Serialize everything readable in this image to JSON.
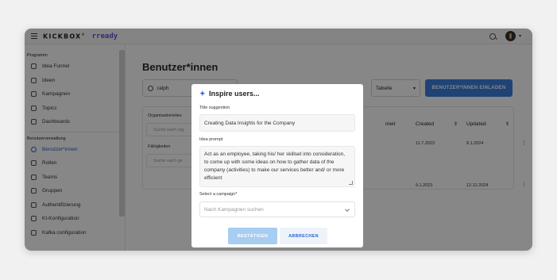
{
  "topbar": {
    "brand": "KICKBOX",
    "brand_mark": "®",
    "product": "rready"
  },
  "sidebar": {
    "section_program": "Programm",
    "program_items": [
      {
        "label": "Idea Funnel",
        "icon": "funnel-icon"
      },
      {
        "label": "Ideen",
        "icon": "lightbulb-icon"
      },
      {
        "label": "Kampagnen",
        "icon": "megaphone-icon"
      },
      {
        "label": "Topics",
        "icon": "tag-icon"
      },
      {
        "label": "Dashboards",
        "icon": "chart-icon"
      }
    ],
    "section_user_admin": "Benutzerverwaltung",
    "admin_items": [
      {
        "label": "Benutzer*innen",
        "icon": "user-icon",
        "active": true
      },
      {
        "label": "Rollen",
        "icon": "roles-icon"
      },
      {
        "label": "Teams",
        "icon": "team-icon"
      },
      {
        "label": "Gruppen",
        "icon": "groups-icon"
      },
      {
        "label": "Authentifizierung",
        "icon": "key-icon"
      },
      {
        "label": "KI-Konfiguration",
        "icon": "ai-icon"
      },
      {
        "label": "Kafka configuration",
        "icon": "kafka-icon"
      }
    ]
  },
  "main": {
    "title": "Benutzer*innen",
    "search_value": "ralph",
    "view_select": "Tabelle",
    "invite_button": "BENUTZER*INNEN EINLADEN",
    "filters": {
      "org_label": "Organisationelles",
      "org_placeholder": "Suche nach org",
      "skills_label": "Fähigkeiten",
      "skills_placeholder": "Suche nach ge"
    },
    "table": {
      "col_partial": "meit",
      "col_created": "Created",
      "col_updated": "Updated",
      "rows": [
        {
          "created": "11.7.2023",
          "updated": "8.1.2024"
        },
        {
          "created": "9.1.2023",
          "updated": "12.12.2024"
        }
      ]
    }
  },
  "modal": {
    "title": "Inspire users...",
    "title_suggestion_label": "Title suggestion",
    "title_suggestion_value": "Creating Data Insights for the Company",
    "idea_prompt_label": "Idea prompt",
    "idea_prompt_value": "Act as an employee, taking his/ her skillset into consideration, to come up with some ideas on how to gather data of the company (activities) to make our services better and/ or more efficient",
    "campaign_label": "Select a campaign*",
    "campaign_placeholder": "Nach Kampagnen suchen",
    "confirm_button": "BESTÄTIGEN",
    "cancel_button": "ABBRECHEN"
  }
}
